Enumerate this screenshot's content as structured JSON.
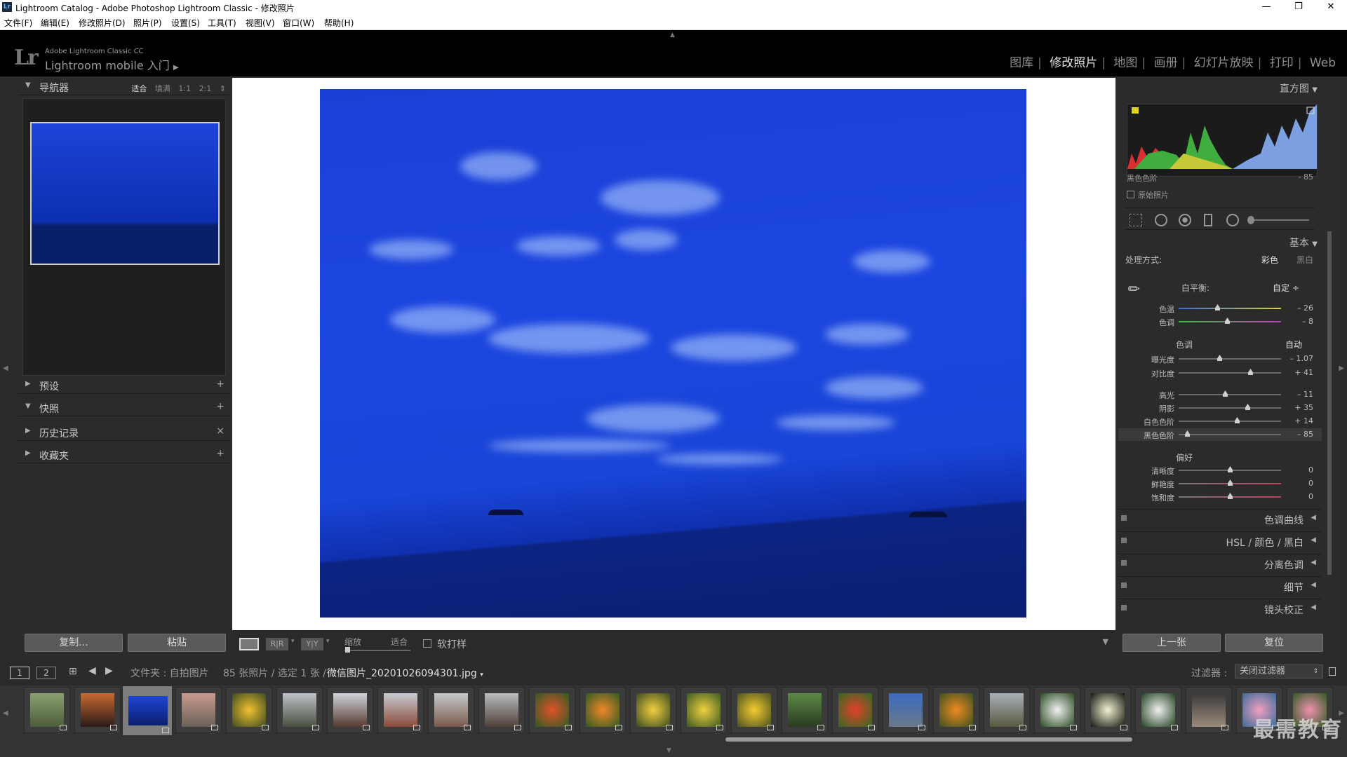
{
  "window": {
    "title": "Lightroom Catalog - Adobe Photoshop Lightroom Classic - 修改照片",
    "minimize": "—",
    "maximize": "❐",
    "close": "✕"
  },
  "menu": [
    "文件(F)",
    "编辑(E)",
    "修改照片(D)",
    "照片(P)",
    "设置(S)",
    "工具(T)",
    "视图(V)",
    "窗口(W)",
    "帮助(H)"
  ],
  "identity": {
    "logo": "Lr",
    "product": "Adobe Lightroom Classic CC",
    "tagline": "Lightroom mobile 入门",
    "arrow": "▶"
  },
  "modules": [
    "图库",
    "修改照片",
    "地图",
    "画册",
    "幻灯片放映",
    "打印",
    "Web"
  ],
  "active_module": "修改照片",
  "left": {
    "navigator": {
      "label": "导航器",
      "options": [
        "适合",
        "填满",
        "1:1",
        "2:1"
      ],
      "active": "适合"
    },
    "presets": {
      "label": "预设",
      "action": "+"
    },
    "snapshots": {
      "label": "快照",
      "action": "+"
    },
    "history": {
      "label": "历史记录",
      "action": "×"
    },
    "collections": {
      "label": "收藏夹",
      "action": "+"
    },
    "copy": "复制...",
    "paste": "粘贴"
  },
  "toolbar": {
    "zoom_label": "缩放",
    "fit_label": "适合",
    "softproof": "软打样"
  },
  "right": {
    "histogram": {
      "label": "直方图",
      "readout_name": "黑色色阶",
      "readout_value": "- 85",
      "original": "原始照片"
    },
    "basic": {
      "label": "基本",
      "treatment_label": "处理方式:",
      "treatment_color": "彩色",
      "treatment_bw": "黑白",
      "wb_label": "白平衡:",
      "wb_value": "自定 ÷",
      "tone_label": "色调",
      "auto": "自动",
      "presence_label": "偏好",
      "sliders": [
        {
          "name": "色温",
          "value": "– 26",
          "level": 0.38
        },
        {
          "name": "色调",
          "value": "– 8",
          "level": 0.47
        },
        {
          "name": "曝光度",
          "value": "– 1.07",
          "level": 0.4
        },
        {
          "name": "对比度",
          "value": "+ 41",
          "level": 0.7
        },
        {
          "name": "高光",
          "value": "– 11",
          "level": 0.45
        },
        {
          "name": "阴影",
          "value": "+ 35",
          "level": 0.67
        },
        {
          "name": "白色色阶",
          "value": "+ 14",
          "level": 0.57
        },
        {
          "name": "黑色色阶",
          "value": "– 85",
          "level": 0.08
        },
        {
          "name": "清晰度",
          "value": "0",
          "level": 0.5
        },
        {
          "name": "鲜艳度",
          "value": "0",
          "level": 0.5
        },
        {
          "name": "饱和度",
          "value": "0",
          "level": 0.5
        }
      ]
    },
    "panels": [
      "色调曲线",
      "HSL  /  颜色  /  黑白",
      "分离色调",
      "细节",
      "镜头校正"
    ],
    "prev": "上一张",
    "reset": "复位"
  },
  "filmbar": {
    "view1": "1",
    "view2": "2",
    "source": "文件夹 : 自拍图片",
    "count": "85 张照片 / 选定 1 张 /",
    "filename": "微信图片_20201026094301.jpg",
    "filter_label": "过滤器 :",
    "filter_value": "关闭过滤器"
  },
  "watermark": "最需教育"
}
